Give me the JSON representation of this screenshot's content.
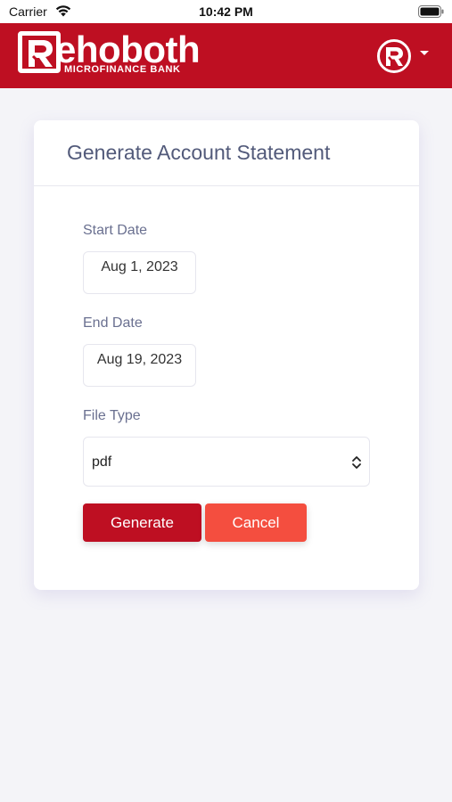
{
  "status_bar": {
    "carrier": "Carrier",
    "time": "10:42 PM"
  },
  "header": {
    "logo_word": "ehoboth",
    "logo_sub": "MICROFINANCE BANK",
    "brand_color": "#be0f22"
  },
  "card": {
    "title": "Generate Account Statement",
    "start_date": {
      "label": "Start Date",
      "value": "Aug 1, 2023"
    },
    "end_date": {
      "label": "End Date",
      "value": "Aug 19, 2023"
    },
    "file_type": {
      "label": "File Type",
      "value": "pdf"
    },
    "generate_label": "Generate",
    "cancel_label": "Cancel"
  },
  "colors": {
    "accent": "#be0f22",
    "cancel": "#f44e3f"
  }
}
